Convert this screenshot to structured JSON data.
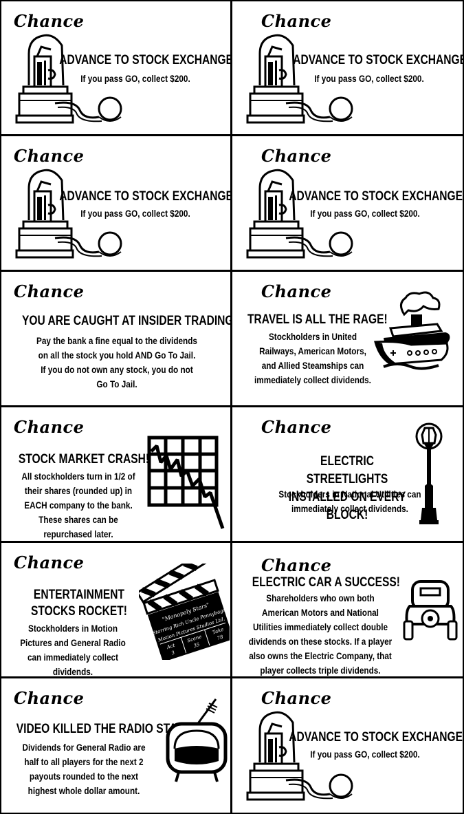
{
  "cards": [
    {
      "header": "Chance",
      "title": "ADVANCE TO STOCK EXCHANGE",
      "body": "If you pass GO, collect $200.",
      "art": "stock-ticker-icon"
    },
    {
      "header": "Chance",
      "title": "ADVANCE TO STOCK EXCHANGE",
      "body": "If you pass GO, collect $200.",
      "art": "stock-ticker-icon"
    },
    {
      "header": "Chance",
      "title": "ADVANCE TO STOCK EXCHANGE",
      "body": "If you pass GO, collect $200.",
      "art": "stock-ticker-icon"
    },
    {
      "header": "Chance",
      "title": "ADVANCE TO STOCK EXCHANGE",
      "body": "If you pass GO, collect $200.",
      "art": "stock-ticker-icon"
    },
    {
      "header": "Chance",
      "title": "YOU ARE CAUGHT AT INSIDER TRADING!",
      "body": "Pay the bank a fine equal to the dividends on all the stock you hold AND Go To Jail. If you do not own any stock, you do not Go To Jail."
    },
    {
      "header": "Chance",
      "title": "TRAVEL IS ALL THE RAGE!",
      "body": "Stockholders in United Railways, American Motors, and Allied Steamships can immediately collect dividends.",
      "art": "steamship-icon"
    },
    {
      "header": "Chance",
      "title": "STOCK MARKET CRASH!",
      "body": "All stockholders turn in 1/2 of their shares (rounded up) in EACH company to the bank. These shares can be repurchased later.",
      "art": "falling-chart-icon"
    },
    {
      "header": "Chance",
      "title": "ELECTRIC STREETLIGHTS INSTALLED ON EVERY BLOCK!",
      "body": "Stockholders in National Utilities can immediately collect dividends.",
      "art": "streetlight-icon"
    },
    {
      "header": "Chance",
      "title": "ENTERTAINMENT STOCKS ROCKET!",
      "body": "Stockholders in Motion Pictures and General Radio can immediately collect dividends.",
      "art": "clapperboard-icon",
      "clapper": {
        "film": "\"Monopoly Stars\"",
        "starring": "Starring Rich Uncle Pennybags",
        "studio": "Motion Pictures Studios Ltd.",
        "act_label": "Act",
        "act": "3",
        "scene_label": "Scene",
        "scene": "35",
        "take_label": "Take",
        "take": "78"
      }
    },
    {
      "header": "Chance",
      "title": "ELECTRIC CAR A SUCCESS!",
      "body": "Shareholders who own both American Motors and National Utilities immediately collect double dividends on these stocks. If a player also owns the Electric Company, that player collects triple dividends.",
      "art": "electric-car-icon"
    },
    {
      "header": "Chance",
      "title": "VIDEO KILLED THE RADIO STAR.",
      "body": "Dividends for General Radio are half to all players for the next 2 payouts rounded to the next highest whole dollar amount.",
      "art": "television-icon"
    },
    {
      "header": "Chance",
      "title": "ADVANCE TO STOCK EXCHANGE",
      "body": "If you pass GO, collect $200.",
      "art": "stock-ticker-icon"
    }
  ]
}
